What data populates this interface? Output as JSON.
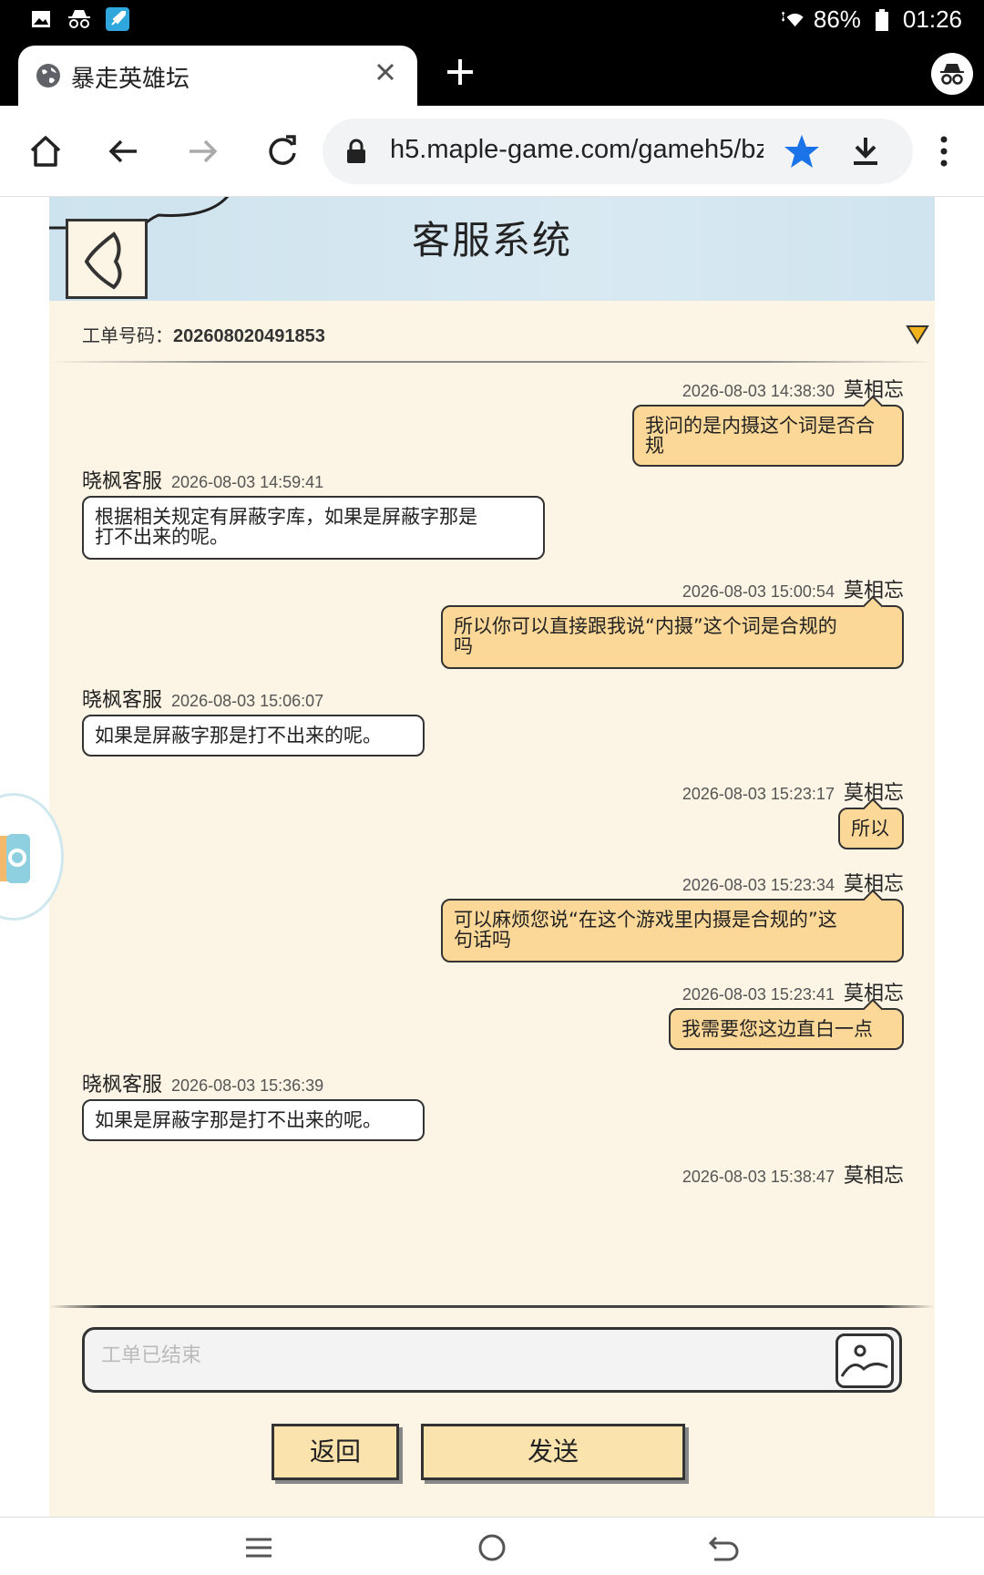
{
  "statusbar": {
    "battery": "86%",
    "time": "01:26"
  },
  "browser": {
    "tab_title": "暴走英雄坛",
    "url": "h5.maple-game.com/gameh5/bz"
  },
  "page": {
    "title": "客服系统",
    "ticket_label": "工单号码：",
    "ticket_number": "202608020491853"
  },
  "messages": [
    {
      "from": "me",
      "name": "莫相忘",
      "time": "2026-08-03 14:38:30",
      "text": "我问的是内摄这个词是否合规"
    },
    {
      "from": "cs",
      "name": "晓枫客服",
      "time": "2026-08-03 14:59:41",
      "line1": "根据相关规定有屏蔽字库，如果是屏蔽字那是",
      "line2": "打不出来的呢。"
    },
    {
      "from": "me",
      "name": "莫相忘",
      "time": "2026-08-03 15:00:54",
      "line1": "所以你可以直接跟我说“内摄”这个词是合规的",
      "line2": "吗"
    },
    {
      "from": "cs",
      "name": "晓枫客服",
      "time": "2026-08-03 15:06:07",
      "text": "如果是屏蔽字那是打不出来的呢。"
    },
    {
      "from": "me",
      "name": "莫相忘",
      "time": "2026-08-03 15:23:17",
      "text": "所以"
    },
    {
      "from": "me",
      "name": "莫相忘",
      "time": "2026-08-03 15:23:34",
      "line1": "可以麻烦您说“在这个游戏里内摄是合规的”这",
      "line2": "句话吗"
    },
    {
      "from": "me",
      "name": "莫相忘",
      "time": "2026-08-03 15:23:41",
      "text": "我需要您这边直白一点"
    },
    {
      "from": "cs",
      "name": "晓枫客服",
      "time": "2026-08-03 15:36:39",
      "text": "如果是屏蔽字那是打不出来的呢。"
    },
    {
      "from": "me",
      "name": "莫相忘",
      "time": "2026-08-03 15:38:47"
    }
  ],
  "composer": {
    "placeholder": "工单已结束"
  },
  "buttons": {
    "back": "返回",
    "send": "发送"
  }
}
